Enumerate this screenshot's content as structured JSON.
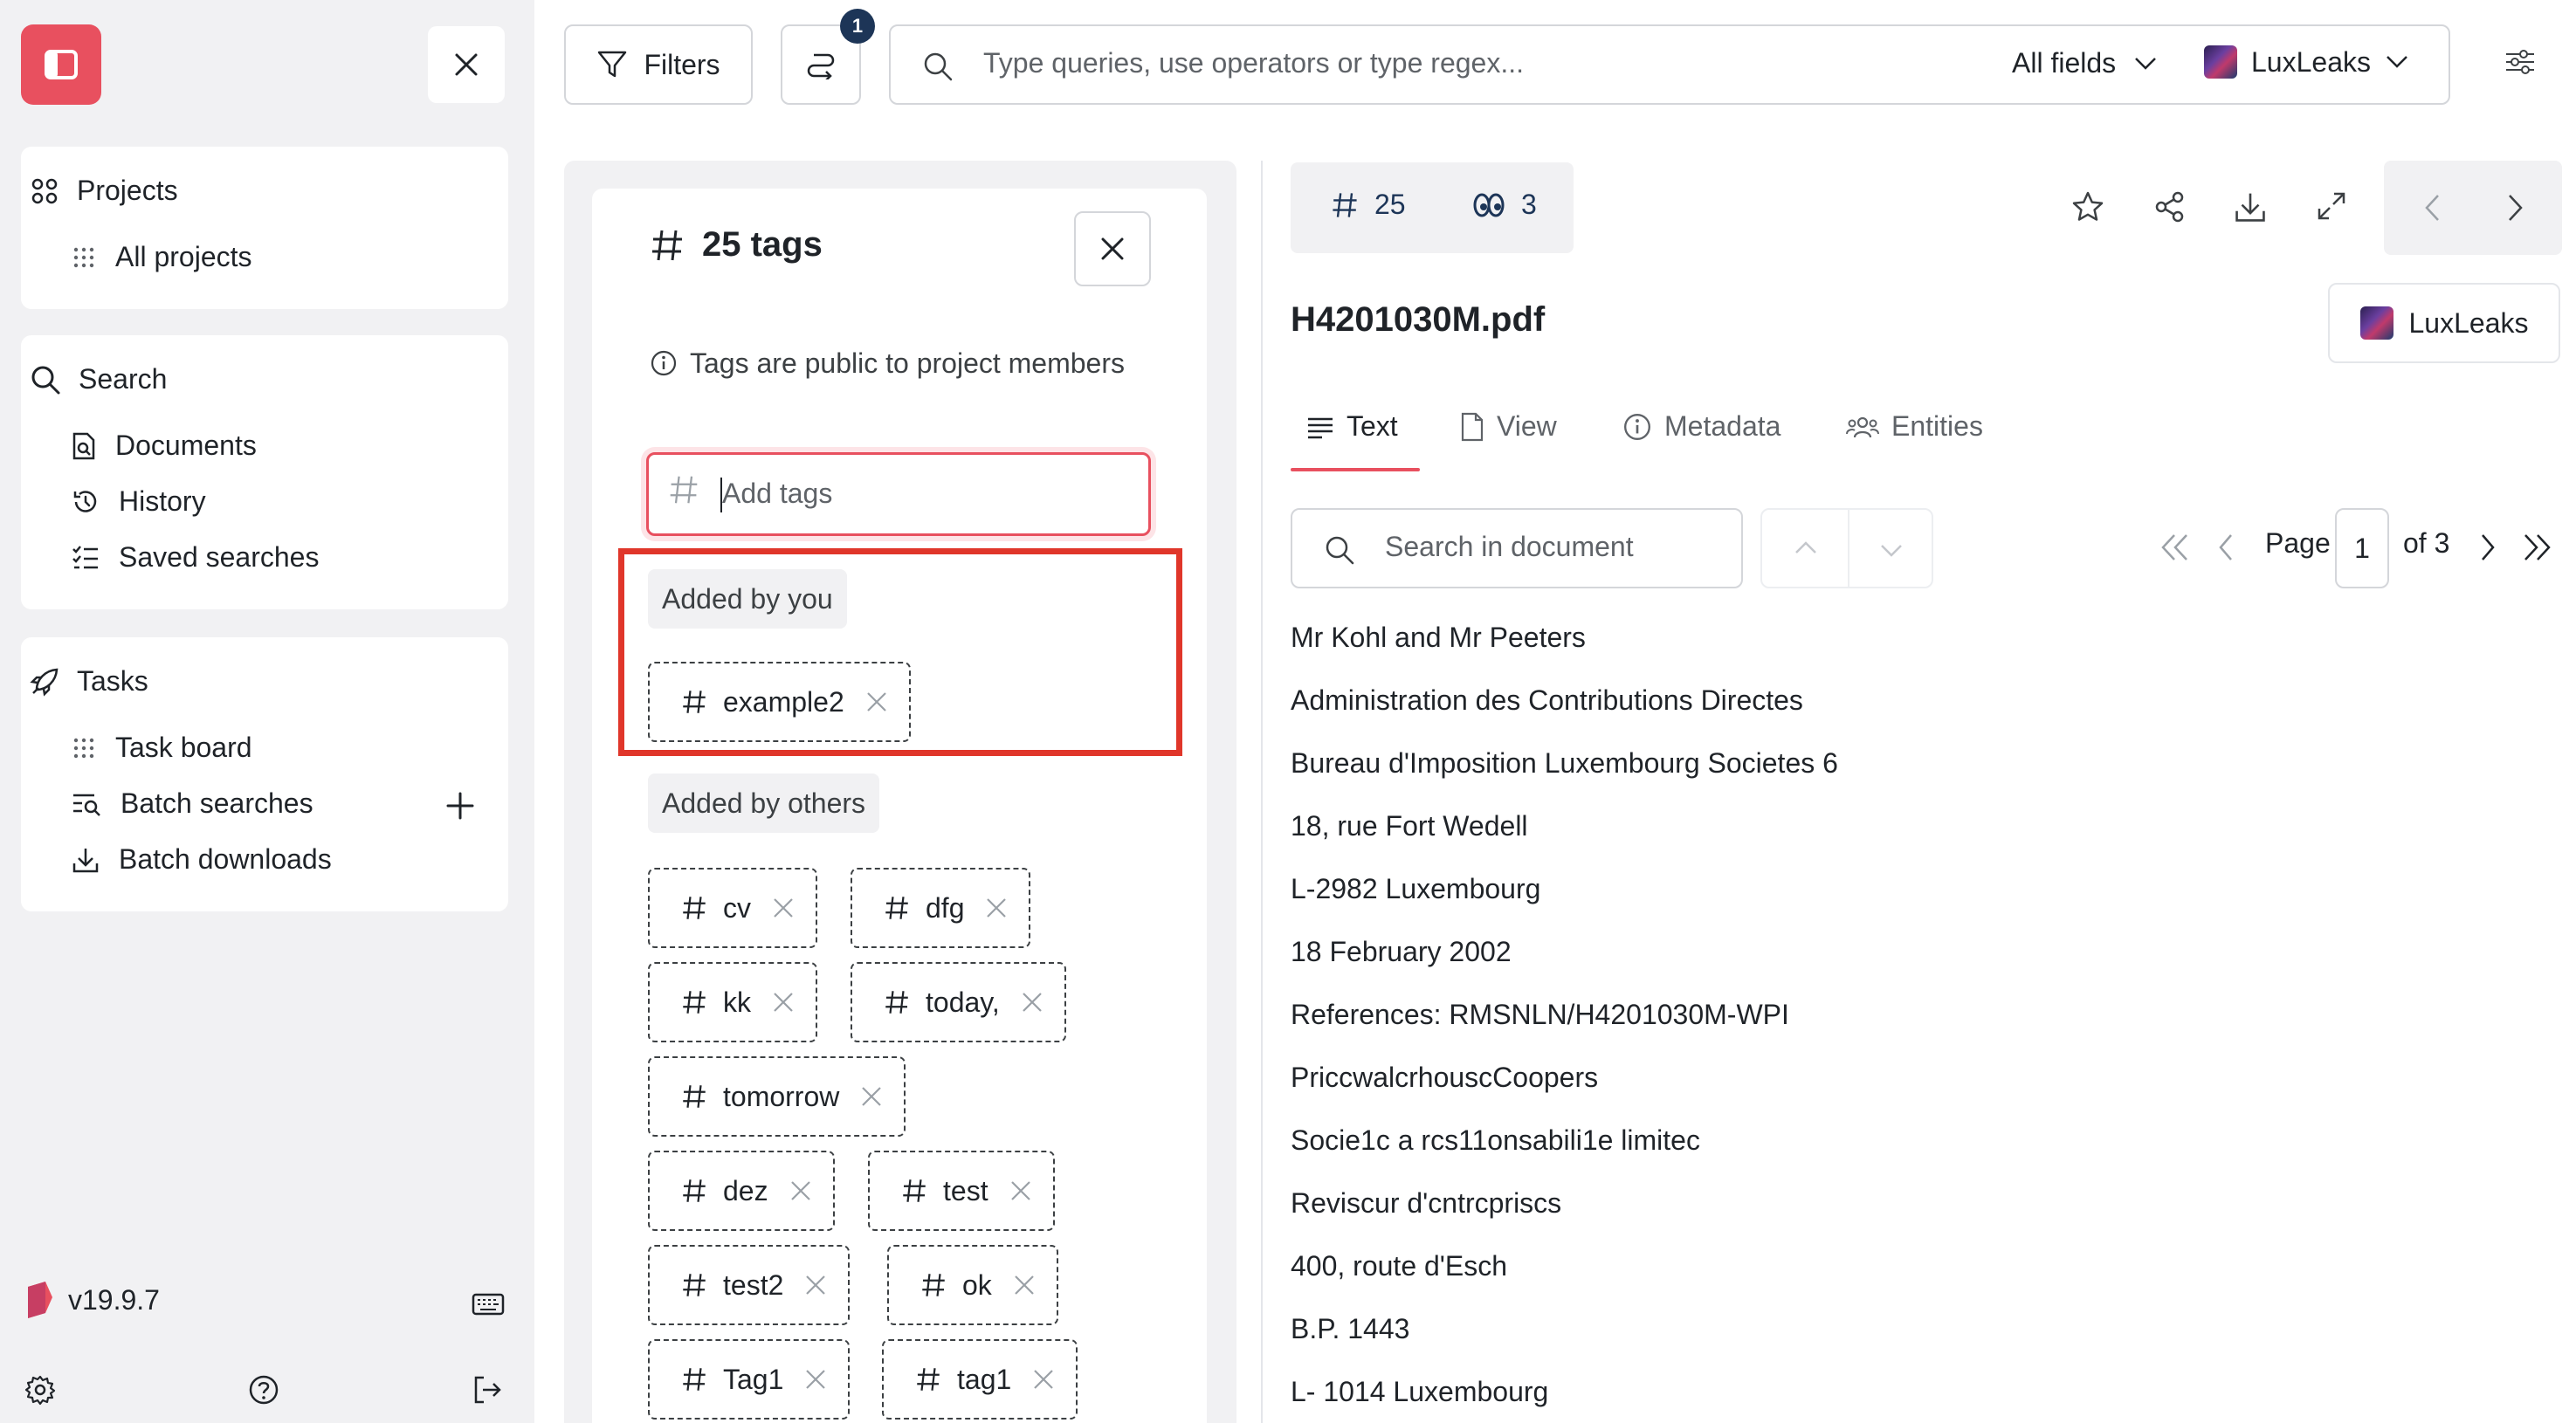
{
  "sidebar": {
    "projects": {
      "title": "Projects",
      "items": [
        "All projects"
      ]
    },
    "search": {
      "title": "Search",
      "items": [
        "Documents",
        "History",
        "Saved searches"
      ]
    },
    "tasks": {
      "title": "Tasks",
      "items": [
        "Task board",
        "Batch searches",
        "Batch downloads"
      ]
    },
    "version": "v19.9.7"
  },
  "topbar": {
    "filters_label": "Filters",
    "history_badge": "1",
    "search_placeholder": "Type queries, use operators or type regex...",
    "field_select": "All fields",
    "project_select": "LuxLeaks"
  },
  "tags_panel": {
    "title": "25 tags",
    "note": "Tags are public to project members",
    "input_placeholder": "Add tags",
    "added_by_you_label": "Added by you",
    "added_by_others_label": "Added by others",
    "mine": [
      "example2"
    ],
    "others": [
      "cv",
      "dfg",
      "kk",
      "today,",
      "tomorrow",
      "dez",
      "test",
      "test2",
      "ok",
      "Tag1",
      "tag1"
    ]
  },
  "document": {
    "tag_count": "25",
    "recommended_count": "3",
    "title": "H4201030M.pdf",
    "project": "LuxLeaks",
    "tabs": [
      "Text",
      "View",
      "Metadata",
      "Entities"
    ],
    "search_placeholder": "Search in document",
    "page_label": "Page",
    "page_current": "1",
    "page_of": "of 3",
    "lines": [
      "Mr Kohl and Mr Peeters",
      "Administration des Contributions Directes",
      "Bureau d'Imposition Luxembourg Societes 6",
      "18, rue Fort Wedell",
      "L-2982 Luxembourg",
      "18 February 2002",
      "References: RMSNLN/H4201030M-WPI",
      "PriccwalcrhouscCoopers",
      "Socie1c a rcs11onsabili1e limitec",
      "Reviscur d'cntrcpriscs",
      "400, route d'Esch",
      "B.P. 1443",
      "L- 1014 Luxembourg"
    ]
  },
  "colors": {
    "accent": "#e8505f",
    "navy": "#1d3557",
    "highlight": "#e0362a"
  }
}
